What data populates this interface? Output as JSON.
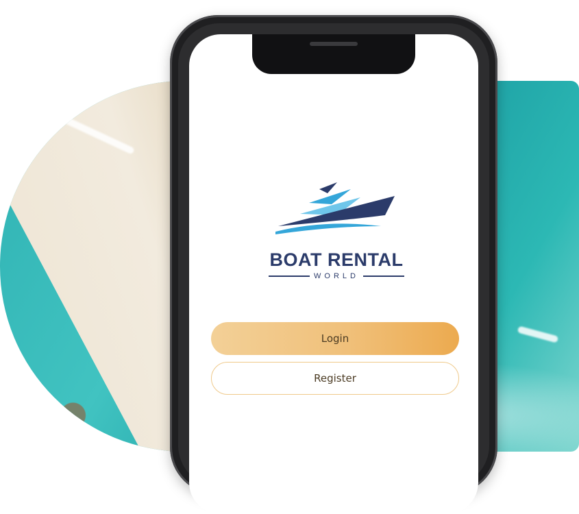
{
  "brand": {
    "name": "BOAT RENTAL",
    "tagline": "WORLD",
    "colors": {
      "navy": "#2b3b6a",
      "sky": "#34a6d9",
      "light_sky": "#6fc6ea"
    }
  },
  "buttons": {
    "login_label": "Login",
    "register_label": "Register",
    "login_gradient": [
      "#f3d097",
      "#ecaa4f"
    ],
    "register_border": "#efc98a"
  },
  "background": {
    "scene": "aerial-beach-photo",
    "icon": "boat-logo-icon"
  }
}
